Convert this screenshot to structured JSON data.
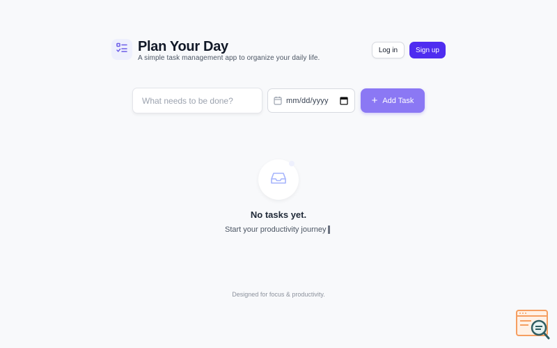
{
  "header": {
    "title": "Plan Your Day",
    "subtitle": "A simple task management app to organize your daily life.",
    "logo_icon": "checklist-icon",
    "login_label": "Log in",
    "signup_label": "Sign up"
  },
  "form": {
    "task_placeholder": "What needs to be done?",
    "date_placeholder": "mm/dd/yyyy",
    "add_label": "Add Task"
  },
  "empty_state": {
    "icon": "inbox-icon",
    "title": "No tasks yet.",
    "subtitle": "Start your productivity journey"
  },
  "footer": {
    "text": "Designed for focus & productivity."
  },
  "colors": {
    "accent": "#4f2df0",
    "accent_light": "#8b78f4",
    "background": "#f8f9fb"
  }
}
